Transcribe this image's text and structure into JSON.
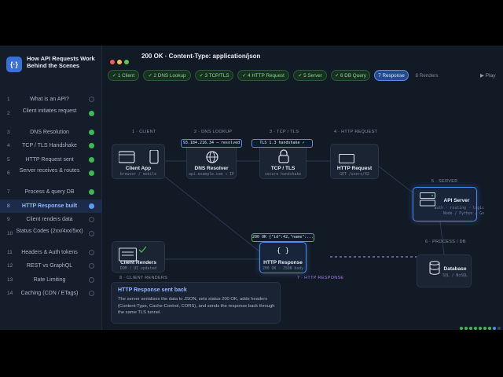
{
  "brand": {
    "icon": "code-icon",
    "title": "How API Requests Work Behind the Scenes"
  },
  "sidebar": {
    "items": [
      {
        "num": "1",
        "label": "What is an API?",
        "state": "todo"
      },
      {
        "num": "2",
        "label": "Client initiates request",
        "state": "done"
      },
      {
        "num": "3",
        "label": "DNS Resolution",
        "state": "done"
      },
      {
        "num": "4",
        "label": "TCP / TLS Handshake",
        "state": "done"
      },
      {
        "num": "5",
        "label": "HTTP Request sent",
        "state": "done"
      },
      {
        "num": "6",
        "label": "Server receives & routes",
        "state": "done"
      },
      {
        "num": "7",
        "label": "Process & query DB",
        "state": "done"
      },
      {
        "num": "8",
        "label": "HTTP Response built",
        "state": "current"
      },
      {
        "num": "9",
        "label": "Client renders data",
        "state": "todo"
      },
      {
        "num": "10",
        "label": "Status Codes (2xx/4xx/5xx)",
        "state": "todo"
      },
      {
        "num": "11",
        "label": "Headers & Auth tokens",
        "state": "todo"
      },
      {
        "num": "12",
        "label": "REST vs GraphQL",
        "state": "todo"
      },
      {
        "num": "13",
        "label": "Rate Limiting",
        "state": "todo"
      },
      {
        "num": "14",
        "label": "Caching (CDN / ETags)",
        "state": "todo"
      }
    ]
  },
  "header": {
    "title": "200 OK · Content-Type: application/json"
  },
  "tabs": [
    {
      "label": "✓ 1 Client",
      "state": "done"
    },
    {
      "label": "✓ 2 DNS Lookup",
      "state": "done"
    },
    {
      "label": "✓ 3 TCP/TLS",
      "state": "done"
    },
    {
      "label": "✓ 4 HTTP Request",
      "state": "done"
    },
    {
      "label": "✓ 5 Server",
      "state": "done"
    },
    {
      "label": "✓ 6 DB Query",
      "state": "done"
    },
    {
      "label": "7 Response",
      "state": "active"
    },
    {
      "label": "8 Renders",
      "state": "pending"
    }
  ],
  "play_label": "▶ Play",
  "stages": {
    "client": "1 · CLIENT",
    "dns": "2 · DNS LOOKUP",
    "tcp": "3 · TCP / TLS",
    "http_request": "4 · HTTP REQUEST",
    "server": "5 · SERVER",
    "process": "6 · PROCESS / DB",
    "http_response": "7 · HTTP RESPONSE",
    "client_renders": "8 · CLIENT RENDERS"
  },
  "nodes": {
    "client_app": {
      "title": "Client App",
      "sub": "browser / mobile"
    },
    "dns": {
      "title": "DNS Resolver",
      "sub": "api.example.com → IP",
      "pill": "93.184.216.34 → resolved"
    },
    "tcp": {
      "title": "TCP / TLS",
      "sub": "secure handshake",
      "pill": "TLS 1.3 handshake ✓"
    },
    "http_request": {
      "title": "HTTP Request",
      "sub": "GET /users/42"
    },
    "api_server": {
      "title": "API Server",
      "sub1": "auth · routing · logic",
      "sub2": "Node / Python / Go"
    },
    "database": {
      "title": "Database",
      "sub": "SQL / NoSQL"
    },
    "http_response": {
      "title": "HTTP Response",
      "sub": "200 OK · JSON body",
      "pill": "200 OK {\"id\":42,\"name\":...}"
    },
    "client_renders": {
      "title": "Client Renders",
      "sub": "DOM / UI updated"
    }
  },
  "caption": {
    "title": "HTTP Response sent back",
    "body": "The server serialises the data to JSON, sets status 200 OK, adds headers (Content-Type, Cache-Control, CORS), and sends the response back through the same TLS tunnel."
  },
  "progress_dots": 9,
  "progress_done": 7,
  "colors": {
    "accent": "#4c8df0",
    "done": "#3cba54",
    "purple": "#a07be8"
  }
}
